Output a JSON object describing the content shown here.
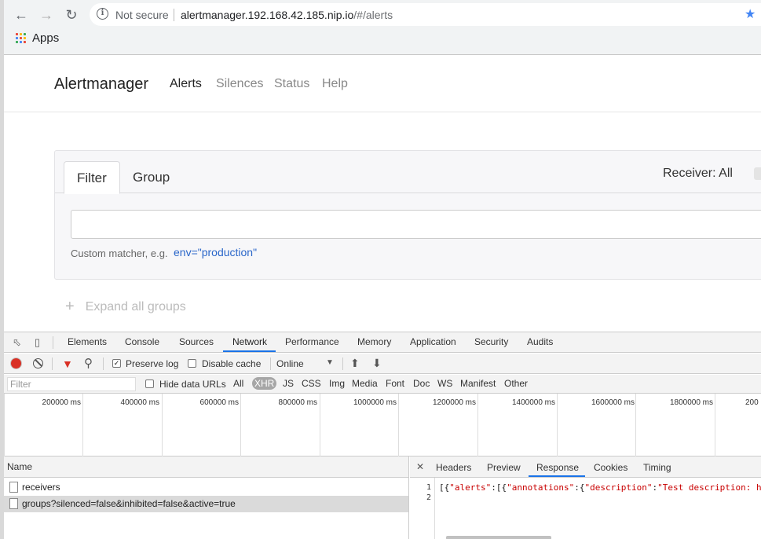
{
  "browser": {
    "security_label": "Not secure",
    "url_host": "alertmanager.192.168.42.185.nip.io",
    "url_path": "/#/alerts",
    "bookmarks_apps": "Apps"
  },
  "app": {
    "brand": "Alertmanager",
    "nav": [
      "Alerts",
      "Silences",
      "Status",
      "Help"
    ],
    "tabs": [
      "Filter",
      "Group"
    ],
    "receiver": "Receiver: All",
    "hint_text": "Custom matcher, e.g.",
    "hint_example": "env=\"production\"",
    "expand_label": "Expand all groups"
  },
  "devtools": {
    "tabs": [
      "Elements",
      "Console",
      "Sources",
      "Network",
      "Performance",
      "Memory",
      "Application",
      "Security",
      "Audits"
    ],
    "active_tab": "Network",
    "preserve_log": "Preserve log",
    "disable_cache": "Disable cache",
    "throttle": "Online",
    "filter_placeholder": "Filter",
    "hide_data_urls": "Hide data URLs",
    "types": [
      "All",
      "XHR",
      "JS",
      "CSS",
      "Img",
      "Media",
      "Font",
      "Doc",
      "WS",
      "Manifest",
      "Other"
    ],
    "active_type": "XHR",
    "timeline_labels": [
      "200000 ms",
      "400000 ms",
      "600000 ms",
      "800000 ms",
      "1000000 ms",
      "1200000 ms",
      "1400000 ms",
      "1600000 ms",
      "1800000 ms",
      "200"
    ],
    "name_header": "Name",
    "requests": [
      "receivers",
      "groups?silenced=false&inhibited=false&active=true"
    ],
    "detail_tabs": [
      "Headers",
      "Preview",
      "Response",
      "Cookies",
      "Timing"
    ],
    "active_detail_tab": "Response",
    "response_line1_prefix": "[{",
    "response_key1": "\"alerts\"",
    "response_mid1": ":[{",
    "response_key2": "\"annotations\"",
    "response_mid2": ":{",
    "response_key3": "\"description\"",
    "response_mid3": ":",
    "response_val": "\"Test description: h",
    "line_numbers": [
      "1",
      "2"
    ]
  },
  "colors": {
    "accent": "#1a73e8",
    "record": "#d93025",
    "link": "#2a66c9"
  }
}
